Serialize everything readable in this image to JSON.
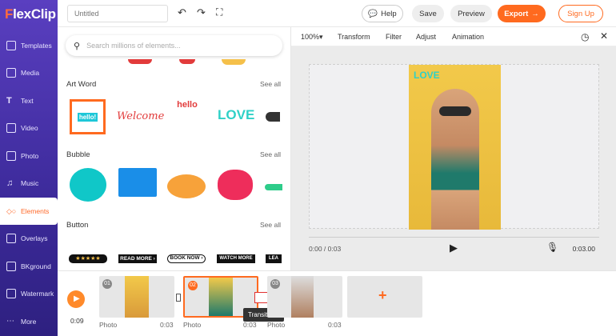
{
  "app": {
    "logo_prefix": "F",
    "logo_rest": "lexClip"
  },
  "sidebar": {
    "items": [
      {
        "label": "Templates",
        "icon": "templates-icon"
      },
      {
        "label": "Media",
        "icon": "media-icon"
      },
      {
        "label": "Text",
        "icon": "text-icon"
      },
      {
        "label": "Video",
        "icon": "video-icon"
      },
      {
        "label": "Photo",
        "icon": "photo-icon"
      },
      {
        "label": "Music",
        "icon": "music-icon"
      },
      {
        "label": "Elements",
        "icon": "elements-icon",
        "active": true
      },
      {
        "label": "Overlays",
        "icon": "overlays-icon"
      },
      {
        "label": "BKground",
        "icon": "background-icon"
      },
      {
        "label": "Watermark",
        "icon": "watermark-icon"
      },
      {
        "label": "More",
        "icon": "more-icon"
      }
    ]
  },
  "topbar": {
    "title_placeholder": "Untitled",
    "help": "Help",
    "save": "Save",
    "preview": "Preview",
    "export": "Export",
    "signup": "Sign Up"
  },
  "panel": {
    "search_placeholder": "Search millions of elements...",
    "sections": [
      {
        "title": "Art Word",
        "see_all": "See all"
      },
      {
        "title": "Bubble",
        "see_all": "See all"
      },
      {
        "title": "Button",
        "see_all": "See all"
      }
    ],
    "artwords": [
      "hello!",
      "Welcome",
      "hello",
      "LOVE"
    ],
    "buttons": [
      "★★★★★",
      "READ MORE ›",
      "BOOK NOW ›",
      "WATCH MORE",
      "LEA"
    ]
  },
  "editbar": {
    "zoom": "100%",
    "tabs": [
      "Transform",
      "Filter",
      "Adjust",
      "Animation"
    ]
  },
  "stage": {
    "overlay_text": "LOVE",
    "current_time": "0:00 / 0:03",
    "duration": "0:03.00"
  },
  "timeline": {
    "time": "0:09",
    "clips": [
      {
        "num": "01",
        "label": "Photo",
        "duration": "0:03"
      },
      {
        "num": "02",
        "label": "Photo",
        "duration": "0:03"
      },
      {
        "num": "03",
        "label": "Photo",
        "duration": "0:03"
      }
    ],
    "tooltip": "Transitions"
  },
  "colors": {
    "accent": "#ff6a1f",
    "sidebar": "#4a33b0",
    "teal": "#2fd1c7"
  }
}
